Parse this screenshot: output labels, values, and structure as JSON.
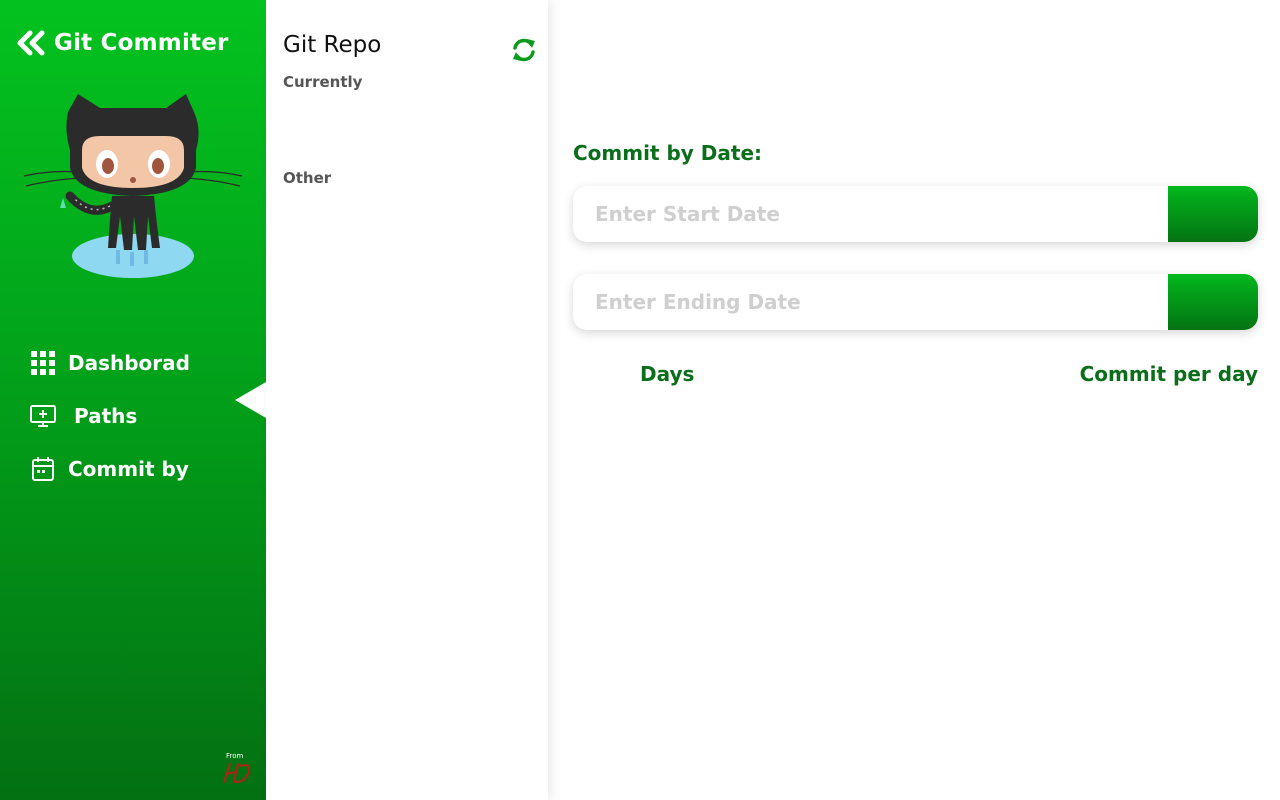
{
  "app": {
    "title": "Git Commiter"
  },
  "sidebar": {
    "items": [
      {
        "label": "Dashborad",
        "icon": "grid-icon"
      },
      {
        "label": "Paths",
        "icon": "monitor-plus-icon"
      },
      {
        "label": "Commit by",
        "icon": "calendar-icon"
      }
    ],
    "footer": "From"
  },
  "repo": {
    "title": "Git Repo",
    "sections": {
      "current": "Currently",
      "other": "Other"
    }
  },
  "main": {
    "section_title": "Commit by Date:",
    "start_date": {
      "placeholder": "Enter Start Date",
      "value": ""
    },
    "end_date": {
      "placeholder": "Enter Ending Date",
      "value": ""
    },
    "columns": {
      "days": "Days",
      "commits": "Commit per day"
    }
  },
  "colors": {
    "accent": "#03b81d",
    "accent_dark": "#037012",
    "heading": "#0a6e1a"
  }
}
